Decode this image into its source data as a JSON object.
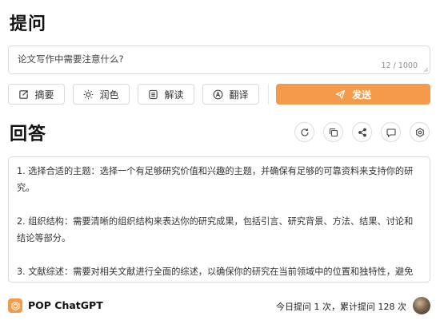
{
  "question_section": {
    "title": "提问",
    "input_value": "论文写作中需要注意什么?",
    "char_count": "12 / 1000"
  },
  "toolbar": {
    "summary_label": "摘要",
    "polish_label": "润色",
    "read_label": "解读",
    "translate_label": "翻译",
    "send_label": "发送"
  },
  "answer_section": {
    "title": "回答",
    "actions": [
      "refresh-icon",
      "copy-icon",
      "share-icon",
      "comment-icon",
      "settings-icon"
    ],
    "paragraphs": [
      "1. 选择合适的主题：选择一个有足够研究价值和兴趣的主题，并确保有足够的可靠资料来支持你的研究。",
      "2. 组织结构：需要清晰的组织结构来表达你的研究成果，包括引言、研究背景、方法、结果、讨论和结论等部分。",
      "3. 文献综述：需要对相关文献进行全面的综述，以确保你的研究在当前领域中的位置和独特性，避免"
    ]
  },
  "footer": {
    "brand": "POP ChatGPT",
    "stats": "今日提问 1 次，累计提问 128 次"
  },
  "colors": {
    "accent": "#f59a4a",
    "border": "#d9d9d9"
  }
}
